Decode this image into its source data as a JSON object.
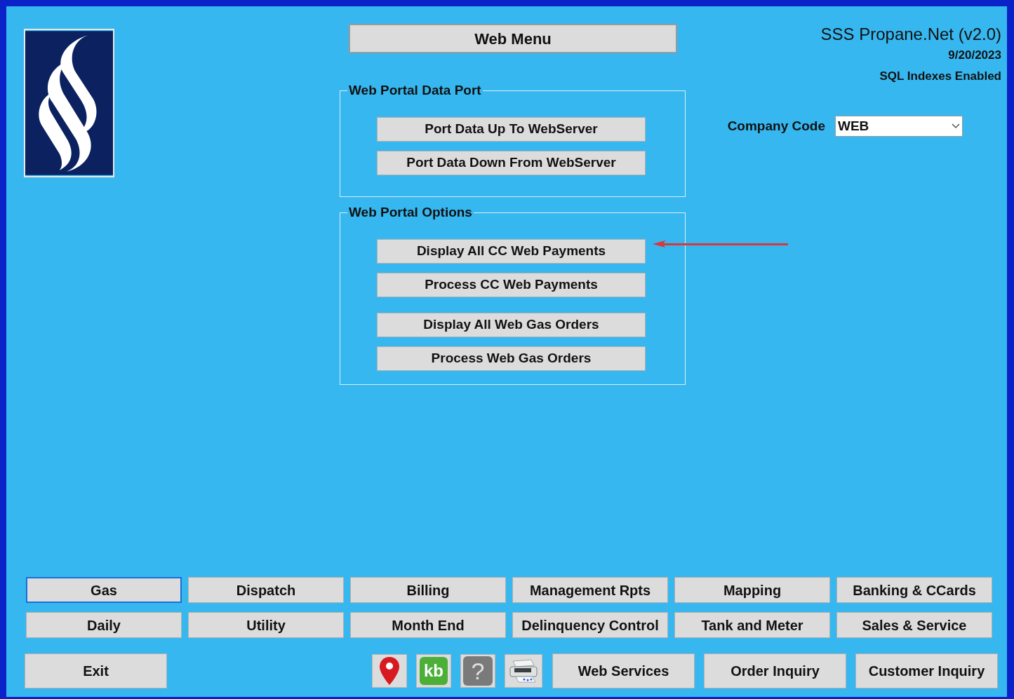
{
  "window": {
    "title": "Web Menu"
  },
  "header": {
    "app_name": "SSS Propane.Net (v2.0)",
    "date": "9/20/2023",
    "status": "SQL Indexes Enabled"
  },
  "company_code": {
    "label": "Company Code",
    "value": "WEB"
  },
  "groups": [
    {
      "title": "Web Portal Data Port",
      "sections": [
        [
          "Port Data Up To WebServer",
          "Port Data Down From WebServer"
        ]
      ]
    },
    {
      "title": "Web Portal Options",
      "sections": [
        [
          "Display All CC Web Payments",
          "Process CC Web Payments"
        ],
        [
          "Display All Web Gas Orders",
          "Process Web Gas Orders"
        ]
      ]
    }
  ],
  "menu_buttons": [
    {
      "label": "Gas",
      "selected": true
    },
    {
      "label": "Dispatch",
      "selected": false
    },
    {
      "label": "Billing",
      "selected": false
    },
    {
      "label": "Management Rpts",
      "selected": false
    },
    {
      "label": "Mapping",
      "selected": false
    },
    {
      "label": "Banking & CCards",
      "selected": false
    },
    {
      "label": "Daily",
      "selected": false
    },
    {
      "label": "Utility",
      "selected": false
    },
    {
      "label": "Month End",
      "selected": false
    },
    {
      "label": "Delinquency Control",
      "selected": false
    },
    {
      "label": "Tank and Meter",
      "selected": false
    },
    {
      "label": "Sales & Service",
      "selected": false
    }
  ],
  "exit_button": "Exit",
  "tool_icons": [
    {
      "kind": "pin"
    },
    {
      "kind": "kb",
      "text": "kb"
    },
    {
      "kind": "help",
      "text": "?"
    },
    {
      "kind": "printer"
    }
  ],
  "bottom_buttons": [
    "Web Services",
    "Order Inquiry",
    "Customer Inquiry"
  ]
}
